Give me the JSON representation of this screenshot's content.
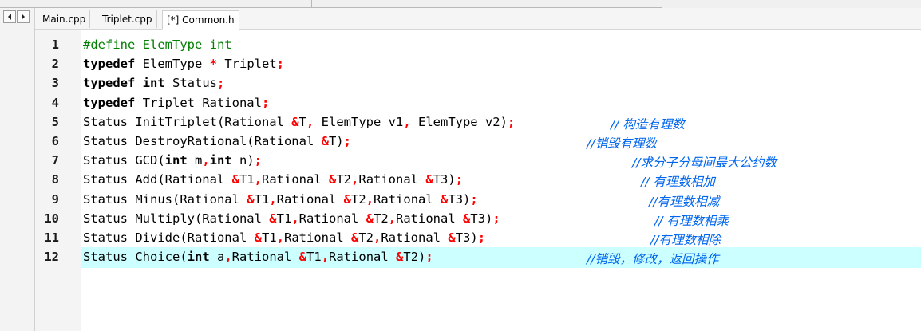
{
  "tabs": [
    "Main.cpp",
    "Triplet.cpp",
    "[*] Common.h"
  ],
  "icons": {
    "nav_left": "arrow-left-icon",
    "nav_right": "arrow-right-icon"
  },
  "colors": {
    "keyword": "#000000",
    "preprocessor": "#008000",
    "operator": "#ff0000",
    "comment": "#0066ee",
    "highlight_line": "#ccffff"
  },
  "lines": [
    {
      "num": "1",
      "code": [
        {
          "t": "pp",
          "s": "#define ElemType int"
        }
      ]
    },
    {
      "num": "2",
      "code": [
        {
          "t": "kw",
          "s": "typedef"
        },
        {
          "t": "tx",
          "s": " ElemType "
        },
        {
          "t": "op",
          "s": "*"
        },
        {
          "t": "tx",
          "s": " Triplet"
        },
        {
          "t": "op",
          "s": ";"
        }
      ]
    },
    {
      "num": "3",
      "code": [
        {
          "t": "kw",
          "s": "typedef"
        },
        {
          "t": "tx",
          "s": " "
        },
        {
          "t": "kw",
          "s": "int"
        },
        {
          "t": "tx",
          "s": " Status"
        },
        {
          "t": "op",
          "s": ";"
        }
      ]
    },
    {
      "num": "4",
      "code": [
        {
          "t": "kw",
          "s": "typedef"
        },
        {
          "t": "tx",
          "s": " Triplet Rational"
        },
        {
          "t": "op",
          "s": ";"
        }
      ]
    },
    {
      "num": "5",
      "code": [
        {
          "t": "tx",
          "s": "Status InitTriplet(Rational "
        },
        {
          "t": "op",
          "s": "&"
        },
        {
          "t": "tx",
          "s": "T"
        },
        {
          "t": "op",
          "s": ","
        },
        {
          "t": "tx",
          "s": " ElemType v1"
        },
        {
          "t": "op",
          "s": ","
        },
        {
          "t": "tx",
          "s": " ElemType v2)"
        },
        {
          "t": "op",
          "s": ";"
        }
      ],
      "comment": "// 构造有理数"
    },
    {
      "num": "6",
      "code": [
        {
          "t": "tx",
          "s": "Status DestroyRational(Rational "
        },
        {
          "t": "op",
          "s": "&"
        },
        {
          "t": "tx",
          "s": "T)"
        },
        {
          "t": "op",
          "s": ";"
        }
      ],
      "comment": "//销毁有理数"
    },
    {
      "num": "7",
      "code": [
        {
          "t": "tx",
          "s": "Status GCD("
        },
        {
          "t": "kw",
          "s": "int"
        },
        {
          "t": "tx",
          "s": " m"
        },
        {
          "t": "op",
          "s": ","
        },
        {
          "t": "kw",
          "s": "int"
        },
        {
          "t": "tx",
          "s": " n)"
        },
        {
          "t": "op",
          "s": ";"
        }
      ],
      "comment": "//求分子分母间最大公约数"
    },
    {
      "num": "8",
      "code": [
        {
          "t": "tx",
          "s": "Status Add(Rational "
        },
        {
          "t": "op",
          "s": "&"
        },
        {
          "t": "tx",
          "s": "T1"
        },
        {
          "t": "op",
          "s": ","
        },
        {
          "t": "tx",
          "s": "Rational "
        },
        {
          "t": "op",
          "s": "&"
        },
        {
          "t": "tx",
          "s": "T2"
        },
        {
          "t": "op",
          "s": ","
        },
        {
          "t": "tx",
          "s": "Rational "
        },
        {
          "t": "op",
          "s": "&"
        },
        {
          "t": "tx",
          "s": "T3)"
        },
        {
          "t": "op",
          "s": ";"
        }
      ],
      "comment": "// 有理数相加"
    },
    {
      "num": "9",
      "code": [
        {
          "t": "tx",
          "s": "Status Minus(Rational "
        },
        {
          "t": "op",
          "s": "&"
        },
        {
          "t": "tx",
          "s": "T1"
        },
        {
          "t": "op",
          "s": ","
        },
        {
          "t": "tx",
          "s": "Rational "
        },
        {
          "t": "op",
          "s": "&"
        },
        {
          "t": "tx",
          "s": "T2"
        },
        {
          "t": "op",
          "s": ","
        },
        {
          "t": "tx",
          "s": "Rational "
        },
        {
          "t": "op",
          "s": "&"
        },
        {
          "t": "tx",
          "s": "T3)"
        },
        {
          "t": "op",
          "s": ";"
        }
      ],
      "comment": "//有理数相减"
    },
    {
      "num": "10",
      "code": [
        {
          "t": "tx",
          "s": "Status Multiply(Rational "
        },
        {
          "t": "op",
          "s": "&"
        },
        {
          "t": "tx",
          "s": "T1"
        },
        {
          "t": "op",
          "s": ","
        },
        {
          "t": "tx",
          "s": "Rational "
        },
        {
          "t": "op",
          "s": "&"
        },
        {
          "t": "tx",
          "s": "T2"
        },
        {
          "t": "op",
          "s": ","
        },
        {
          "t": "tx",
          "s": "Rational "
        },
        {
          "t": "op",
          "s": "&"
        },
        {
          "t": "tx",
          "s": "T3)"
        },
        {
          "t": "op",
          "s": ";"
        }
      ],
      "comment": "// 有理数相乘"
    },
    {
      "num": "11",
      "code": [
        {
          "t": "tx",
          "s": "Status Divide(Rational "
        },
        {
          "t": "op",
          "s": "&"
        },
        {
          "t": "tx",
          "s": "T1"
        },
        {
          "t": "op",
          "s": ","
        },
        {
          "t": "tx",
          "s": "Rational "
        },
        {
          "t": "op",
          "s": "&"
        },
        {
          "t": "tx",
          "s": "T2"
        },
        {
          "t": "op",
          "s": ","
        },
        {
          "t": "tx",
          "s": "Rational "
        },
        {
          "t": "op",
          "s": "&"
        },
        {
          "t": "tx",
          "s": "T3)"
        },
        {
          "t": "op",
          "s": ";"
        }
      ],
      "comment": "//有理数相除"
    },
    {
      "num": "12",
      "code": [
        {
          "t": "tx",
          "s": "Status Choice("
        },
        {
          "t": "kw",
          "s": "int"
        },
        {
          "t": "tx",
          "s": " a"
        },
        {
          "t": "op",
          "s": ","
        },
        {
          "t": "tx",
          "s": "Rational "
        },
        {
          "t": "op",
          "s": "&"
        },
        {
          "t": "tx",
          "s": "T1"
        },
        {
          "t": "op",
          "s": ","
        },
        {
          "t": "tx",
          "s": "Rational "
        },
        {
          "t": "op",
          "s": "&"
        },
        {
          "t": "tx",
          "s": "T2)"
        },
        {
          "t": "op",
          "s": ";"
        }
      ],
      "comment": "//销毁，修改，返回操作",
      "highlighted": true
    }
  ]
}
